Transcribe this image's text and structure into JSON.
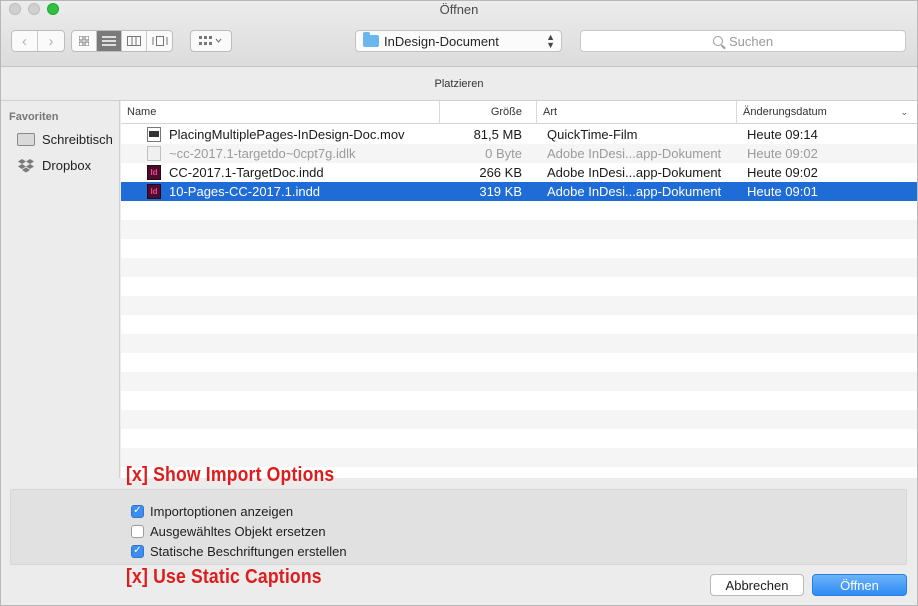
{
  "window": {
    "title": "Öffnen"
  },
  "toolbar": {
    "nav_back_icon": "chevron-left-icon",
    "nav_forward_icon": "chevron-right-icon",
    "view_modes": [
      "icon-view",
      "list-view",
      "column-view",
      "coverflow-view"
    ],
    "active_view": "list-view",
    "arrange_icon": "arrange-grid-icon",
    "location": "InDesign-Document",
    "search_placeholder": "Suchen"
  },
  "header": {
    "label": "Platzieren"
  },
  "sidebar": {
    "heading": "Favoriten",
    "items": [
      {
        "label": "Schreibtisch",
        "icon": "desktop-icon"
      },
      {
        "label": "Dropbox",
        "icon": "dropbox-icon"
      }
    ]
  },
  "file_list": {
    "columns": {
      "name": "Name",
      "size": "Größe",
      "kind": "Art",
      "date": "Änderungsdatum"
    },
    "sort_indicator": "chevron-down-icon",
    "rows": [
      {
        "name": "PlacingMultiplePages-InDesign-Doc.mov",
        "size": "81,5 MB",
        "kind": "QuickTime-Film",
        "date": "Heute 09:14",
        "icon": "movie-file-icon",
        "state": "normal"
      },
      {
        "name": "~cc-2017.1-targetdo~0cpt7g.idlk",
        "size": "0 Byte",
        "kind": "Adobe InDesi...app-Dokument",
        "date": "Heute 09:02",
        "icon": "lock-file-icon",
        "state": "dimmed"
      },
      {
        "name": "CC-2017.1-TargetDoc.indd",
        "size": "266 KB",
        "kind": "Adobe InDesi...app-Dokument",
        "date": "Heute 09:02",
        "icon": "indesign-file-icon",
        "state": "normal"
      },
      {
        "name": "10-Pages-CC-2017.1.indd",
        "size": "319 KB",
        "kind": "Adobe InDesi...app-Dokument",
        "date": "Heute 09:01",
        "icon": "indesign-file-icon",
        "state": "selected"
      }
    ]
  },
  "options": {
    "items": [
      {
        "label": "Importoptionen anzeigen",
        "checked": true
      },
      {
        "label": "Ausgewähltes Objekt ersetzen",
        "checked": false
      },
      {
        "label": "Statische Beschriftungen erstellen",
        "checked": true
      }
    ]
  },
  "annotations": {
    "top": "[x] Show Import Options",
    "bottom": "[x] Use Static Captions"
  },
  "buttons": {
    "cancel": "Abbrechen",
    "open": "Öffnen"
  },
  "colors": {
    "selection": "#1f6cd6",
    "primary_button": "#2e8bf5",
    "annotation": "#e01b1b",
    "checkbox_checked": "#3e8ef0"
  }
}
